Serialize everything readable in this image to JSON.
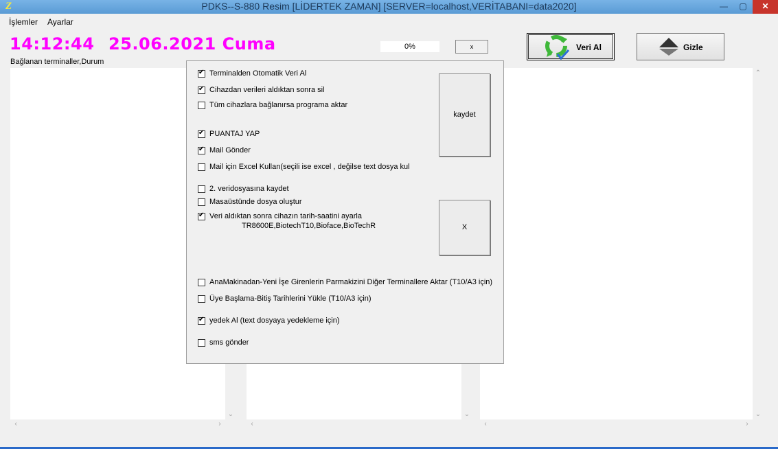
{
  "window": {
    "title": "PDKS--S-880 Resim [LİDERTEK ZAMAN] [SERVER=localhost,VERİTABANI=data2020]",
    "icon_glyph": "Z",
    "minimize_glyph": "—",
    "maximize_glyph": "▢",
    "close_glyph": "✕"
  },
  "menu": {
    "items": [
      "İşlemler",
      "Ayarlar"
    ]
  },
  "header": {
    "time": "14:12:44",
    "date": "25.06.2021 Cuma",
    "terminals_caption": "Bağlanan terminaller,Durum",
    "progress": "0%",
    "small_button": "x",
    "veri_al_label": "Veri Al",
    "gizle_label": "Gizle"
  },
  "dialog": {
    "options": [
      {
        "label": "Terminalden Otomatik Veri Al",
        "checked": true
      },
      {
        "label": "Cihazdan verileri aldıktan sonra sil",
        "checked": true
      },
      {
        "label": "Tüm cihazlara bağlanırsa programa aktar",
        "checked": false
      },
      {
        "label": "PUANTAJ YAP",
        "checked": true
      },
      {
        "label": "Mail Gönder",
        "checked": true
      },
      {
        "label": "Mail için Excel Kullan(seçili ise excel , değilse text dosya kul",
        "checked": false
      },
      {
        "label": "2. veridosyasına kaydet",
        "checked": false
      },
      {
        "label": "Masaüstünde dosya oluştur",
        "checked": false
      },
      {
        "label": "Veri aldıktan sonra cihazın tarih-saatini ayarla",
        "checked": true
      },
      {
        "label": "AnaMakinadan-Yeni İşe Girenlerin Parmakizini Diğer Terminallere Aktar (T10/A3 için)",
        "checked": false
      },
      {
        "label": "Üye Başlama-Bitiş Tarihlerini Yükle (T10/A3 için)",
        "checked": false
      },
      {
        "label": "yedek Al (text dosyaya yedekleme için)",
        "checked": true
      },
      {
        "label": "sms gönder",
        "checked": false
      }
    ],
    "devices_note": "TR8600E,BiotechT10,Bioface,BioTechR",
    "save_label": "kaydet",
    "close_label": "X"
  },
  "colors": {
    "clock": "#ff00ff",
    "titlebar": "#5a9bd5",
    "close": "#c7342b"
  },
  "icons": {
    "veri_al": "recycle-check-icon",
    "gizle": "hide-arrow-icon"
  }
}
